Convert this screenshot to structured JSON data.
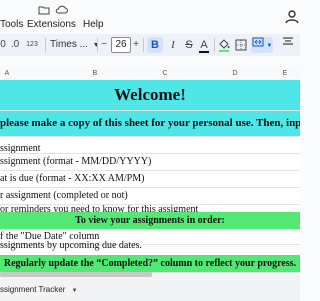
{
  "menu": {
    "icons": [
      "folder-move-icon",
      "cloud-icon"
    ],
    "items": [
      "Tools",
      "Extensions",
      "Help"
    ]
  },
  "toolbar": {
    "font_name": "Times ...",
    "font_size": "26",
    "bold_label": "B",
    "italic_label": "I",
    "strike_label": "S",
    "text_color_label": "A",
    "number_format_label": "123",
    "decrease_label": "−",
    "increase_label": "+"
  },
  "columns": [
    "A",
    "B",
    "C",
    "D",
    "E"
  ],
  "sheet": {
    "title": "Welcome!",
    "intro": "please make a copy of this sheet for your personal use. Then, input the in",
    "lines": [
      "ssignment",
      "ssignment (format - MM/DD/YYYY)",
      "at is due (format - XX:XX AM/PM)",
      "r assignment (completed or not)",
      "or reminders you need to know for this assigment"
    ],
    "order_heading": "To view your assignments in order:",
    "order_lines": [
      "f the \"Due Date\" column",
      "ssignments by upcoming due dates."
    ],
    "footer_note": "Regularly update the “Completed?” column to reflect your progress."
  },
  "tabs": {
    "active": "ssignment Tracker"
  },
  "colors": {
    "title_bg": "#4ee6e6",
    "banner_bg": "#53e874",
    "toolbar_bg": "#eef2f8"
  }
}
